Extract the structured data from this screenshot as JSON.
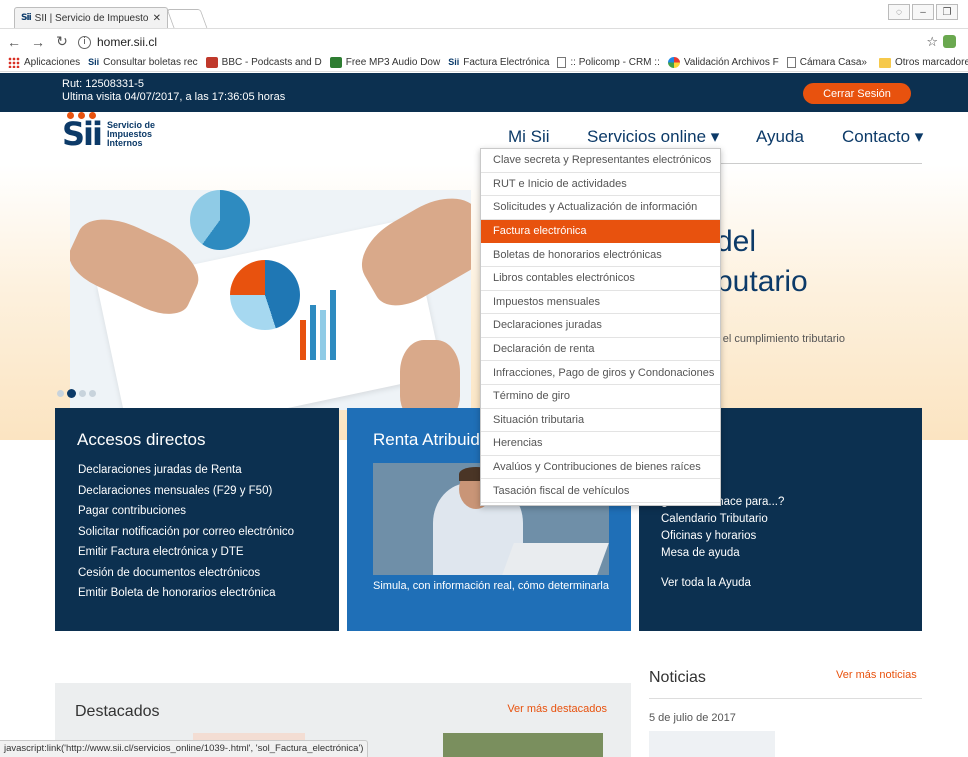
{
  "browser": {
    "tab_title": "SII | Servicio de Impuesto",
    "tab_favicon": "Sii",
    "url": "homer.sii.cl",
    "bookmarks": [
      {
        "label": "Aplicaciones",
        "icon": "apps-icon"
      },
      {
        "label": "Consultar boletas rec",
        "icon": "sii-icon"
      },
      {
        "label": "BBC - Podcasts and D",
        "icon": "bbc-icon"
      },
      {
        "label": "Free MP3 Audio Dow",
        "icon": "mp3-icon"
      },
      {
        "label": "Factura Electrónica",
        "icon": "sii-icon"
      },
      {
        "label": ":: Policomp - CRM ::",
        "icon": "page-icon"
      },
      {
        "label": "Validación Archivos F",
        "icon": "validation-icon"
      },
      {
        "label": "Cámara Casa",
        "icon": "page-icon"
      }
    ],
    "bookmarks_more": "»",
    "other_bookmarks": "Otros marcadores",
    "status_text": "javascript:link('http://www.sii.cl/servicios_online/1039-.html', 'sol_Factura_electrónica')"
  },
  "user": {
    "rut": "Rut: 12508331-5",
    "last_visit": "Ultima visita 04/07/2017, a las 17:36:05 horas",
    "logout_label": "Cerrar Sesión"
  },
  "logo": {
    "mark": "Sii",
    "line1": "Servicio de",
    "line2": "Impuestos",
    "line3": "Internos"
  },
  "nav": {
    "mi_sii": "Mi Sii",
    "servicios": "Servicios online ▾",
    "ayuda": "Ayuda",
    "contacto": "Contacto ▾"
  },
  "dropdown": {
    "items": [
      "Clave secreta y Representantes electrónicos",
      "RUT e Inicio de actividades",
      "Solicitudes y Actualización de información",
      "Factura electrónica",
      "Boletas de honorarios electrónicas",
      "Libros contables electrónicos",
      "Impuestos mensuales",
      "Declaraciones juradas",
      "Declaración de renta",
      "Infracciones, Pago de giros y Condonaciones",
      "Término de giro",
      "Situación tributaria",
      "Herencias",
      "Avalúos y Contribuciones de bienes raíces",
      "Tasación fiscal de vehículos"
    ],
    "active_index": 3
  },
  "hero": {
    "title_line1": "del",
    "title_line2": "butario",
    "subtitle": "r el cumplimiento tributario"
  },
  "accesos": {
    "title": "Accesos directos",
    "links": [
      "Declaraciones juradas de Renta",
      "Declaraciones mensuales (F29 y F50)",
      "Pagar contribuciones",
      "Solicitar notificación por correo electrónico",
      "Emitir Factura electrónica y DTE",
      "Cesión de documentos electrónicos",
      "Emitir Boleta de honorarios electrónica"
    ]
  },
  "renta": {
    "title": "Renta Atribuida",
    "caption": "Simula, con información real, cómo determinarla"
  },
  "ayuda_panel": {
    "links": [
      "s",
      "recuentes",
      "¿Cómo se hace para...?",
      "Calendario Tributario",
      "Oficinas y horarios",
      "Mesa de ayuda"
    ],
    "all": "Ver toda la Ayuda"
  },
  "destacados": {
    "title": "Destacados",
    "more": "Ver más destacados"
  },
  "noticias": {
    "title": "Noticias",
    "more": "Ver más noticias",
    "date": "5 de julio de 2017"
  },
  "colors": {
    "navy": "#0c3050",
    "orange": "#e8520e",
    "blue": "#1f6fb7"
  }
}
